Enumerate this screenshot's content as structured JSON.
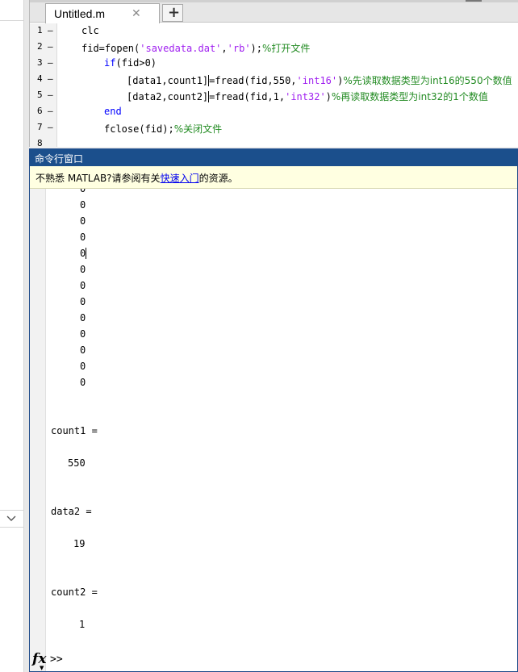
{
  "editor": {
    "tab_title": "Untitled.m",
    "tab_close": "✕",
    "add_tab": "+"
  },
  "code_lines": [
    {
      "num": "1",
      "dash": "–",
      "parts": [
        {
          "t": "clc",
          "c": ""
        }
      ]
    },
    {
      "num": "2",
      "dash": "–",
      "parts": [
        {
          "t": "fid=fopen(",
          "c": ""
        },
        {
          "t": "'savedata.dat'",
          "c": "str"
        },
        {
          "t": ",",
          "c": ""
        },
        {
          "t": "'rb'",
          "c": "str"
        },
        {
          "t": ");",
          "c": ""
        },
        {
          "t": "%打开文件",
          "c": "cmt"
        }
      ]
    },
    {
      "num": "3",
      "dash": "–",
      "parts": [
        {
          "t": "if",
          "c": "kw"
        },
        {
          "t": "(fid>0)",
          "c": ""
        }
      ]
    },
    {
      "num": "4",
      "dash": "–",
      "parts": [
        {
          "t": "[data1,count1]",
          "c": ""
        },
        {
          "t": "=",
          "c": "cur"
        },
        {
          "t": "fread(fid,550,",
          "c": ""
        },
        {
          "t": "'int16'",
          "c": "str"
        },
        {
          "t": ")",
          "c": ""
        },
        {
          "t": "%先读取数据类型为int16的550个数值",
          "c": "cmt"
        }
      ]
    },
    {
      "num": "5",
      "dash": "–",
      "parts": [
        {
          "t": "[data2,count2]",
          "c": ""
        },
        {
          "t": "=",
          "c": "cur"
        },
        {
          "t": "fread(fid,1,",
          "c": ""
        },
        {
          "t": "'int32'",
          "c": "str"
        },
        {
          "t": ")",
          "c": ""
        },
        {
          "t": "%再读取数据类型为int32的1个数值",
          "c": "cmt"
        }
      ]
    },
    {
      "num": "6",
      "dash": "–",
      "parts": [
        {
          "t": "end",
          "c": "kw"
        }
      ]
    },
    {
      "num": "7",
      "dash": "–",
      "parts": [
        {
          "t": "fclose(fid);",
          "c": ""
        },
        {
          "t": "%关闭文件",
          "c": "cmt"
        }
      ]
    },
    {
      "num": "8",
      "dash": "",
      "parts": []
    }
  ],
  "command_window": {
    "title": "命令行窗口",
    "notice_prefix": "不熟悉 MATLAB?请参阅有关",
    "notice_link": "快速入门",
    "notice_suffix": "的资源。",
    "output": [
      {
        "text": "0",
        "indent": "data"
      },
      {
        "text": "0",
        "indent": "data"
      },
      {
        "text": "0",
        "indent": "data"
      },
      {
        "text": "0",
        "indent": "data"
      },
      {
        "text": "0",
        "indent": "data"
      },
      {
        "text": "0",
        "indent": "data"
      },
      {
        "text": "0",
        "indent": "data"
      },
      {
        "text": "0",
        "indent": "data"
      },
      {
        "text": "0",
        "indent": "data"
      },
      {
        "text": "0",
        "indent": "data"
      },
      {
        "text": "0",
        "indent": "data"
      },
      {
        "text": "0",
        "indent": "data"
      },
      {
        "text": "0",
        "indent": "data"
      },
      {
        "text": "",
        "indent": "none"
      },
      {
        "text": "",
        "indent": "none"
      },
      {
        "text": "count1 =",
        "indent": "var"
      },
      {
        "text": "",
        "indent": "none"
      },
      {
        "text": "550",
        "indent": "val3"
      },
      {
        "text": "",
        "indent": "none"
      },
      {
        "text": "",
        "indent": "none"
      },
      {
        "text": "data2 =",
        "indent": "var"
      },
      {
        "text": "",
        "indent": "none"
      },
      {
        "text": "19",
        "indent": "val2"
      },
      {
        "text": "",
        "indent": "none"
      },
      {
        "text": "",
        "indent": "none"
      },
      {
        "text": "count2 =",
        "indent": "var"
      },
      {
        "text": "",
        "indent": "none"
      },
      {
        "text": "1",
        "indent": "val1"
      }
    ],
    "prompt": ">>",
    "fx_label": "fx",
    "fx_caret": "▼"
  }
}
